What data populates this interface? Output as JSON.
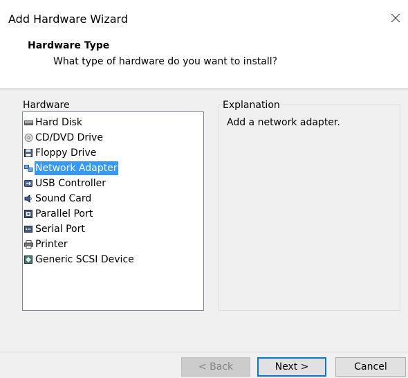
{
  "window": {
    "title": "Add Hardware Wizard"
  },
  "header": {
    "title": "Hardware Type",
    "subtitle": "What type of hardware do you want to install?"
  },
  "hardware_group": {
    "label": "Hardware",
    "items": [
      {
        "label": "Hard Disk",
        "icon": "hard-disk-icon"
      },
      {
        "label": "CD/DVD Drive",
        "icon": "cd-dvd-icon"
      },
      {
        "label": "Floppy Drive",
        "icon": "floppy-icon"
      },
      {
        "label": "Network Adapter",
        "icon": "network-adapter-icon",
        "selected": true
      },
      {
        "label": "USB Controller",
        "icon": "usb-icon"
      },
      {
        "label": "Sound Card",
        "icon": "speaker-icon"
      },
      {
        "label": "Parallel Port",
        "icon": "parallel-port-icon"
      },
      {
        "label": "Serial Port",
        "icon": "serial-port-icon"
      },
      {
        "label": "Printer",
        "icon": "printer-icon"
      },
      {
        "label": "Generic SCSI Device",
        "icon": "scsi-icon"
      }
    ]
  },
  "explanation": {
    "label": "Explanation",
    "text": "Add a network adapter."
  },
  "buttons": {
    "back": "< Back",
    "next": "Next >",
    "cancel": "Cancel"
  },
  "colors": {
    "selection": "#3399ff",
    "default_button_border": "#0078d7"
  }
}
